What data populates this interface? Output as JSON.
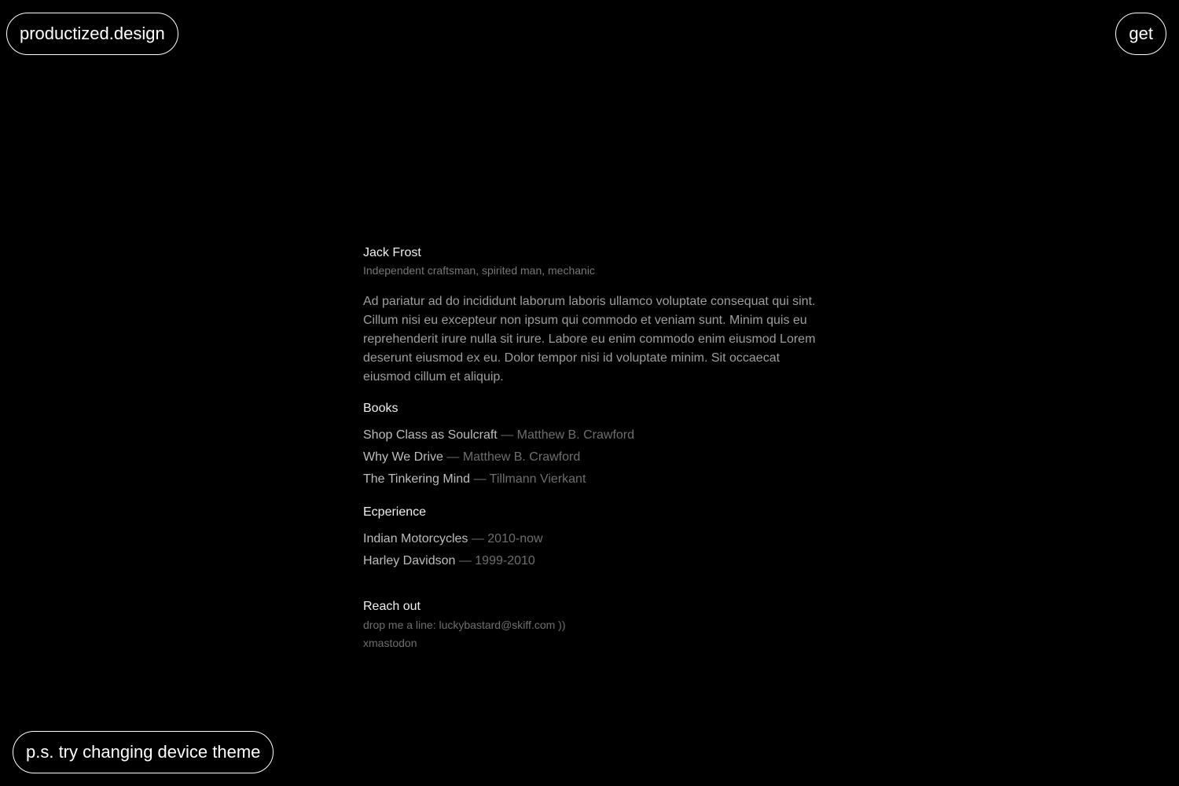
{
  "header": {
    "brand": "productized.design",
    "get_label": "get"
  },
  "profile": {
    "name": "Jack Frost",
    "subtitle": "Independent craftsman, spirited man, mechanic",
    "bio": "Ad pariatur ad do incididunt laborum laboris ullamco voluptate consequat qui sint. Cillum nisi eu excepteur non ipsum qui commodo et veniam sunt. Minim quis eu reprehenderit irure nulla sit irure. Labore eu enim commodo enim eiusmod Lorem deserunt eiusmod ex eu. Dolor tempor nisi id voluptate minim. Sit occaecat eiusmod cillum et aliquip."
  },
  "books": {
    "title": "Books",
    "items": [
      {
        "title": "Shop Class as Soulcraft",
        "author": "Matthew B. Crawford"
      },
      {
        "title": "Why We Drive",
        "author": "Matthew B. Crawford"
      },
      {
        "title": "The Tinkering Mind",
        "author": "Tillmann Vierkant"
      }
    ]
  },
  "experience": {
    "title": "Ecperience",
    "items": [
      {
        "company": "Indian Motorcycles",
        "period": "2010-now"
      },
      {
        "company": "Harley Davidson",
        "period": "1999-2010"
      }
    ]
  },
  "reach_out": {
    "title": "Reach out",
    "email_line": "drop me a line: luckybastard@skiff.com ))",
    "mastodon": "xmastodon"
  },
  "separator": " — ",
  "footer": {
    "ps": "p.s. try changing device theme"
  }
}
